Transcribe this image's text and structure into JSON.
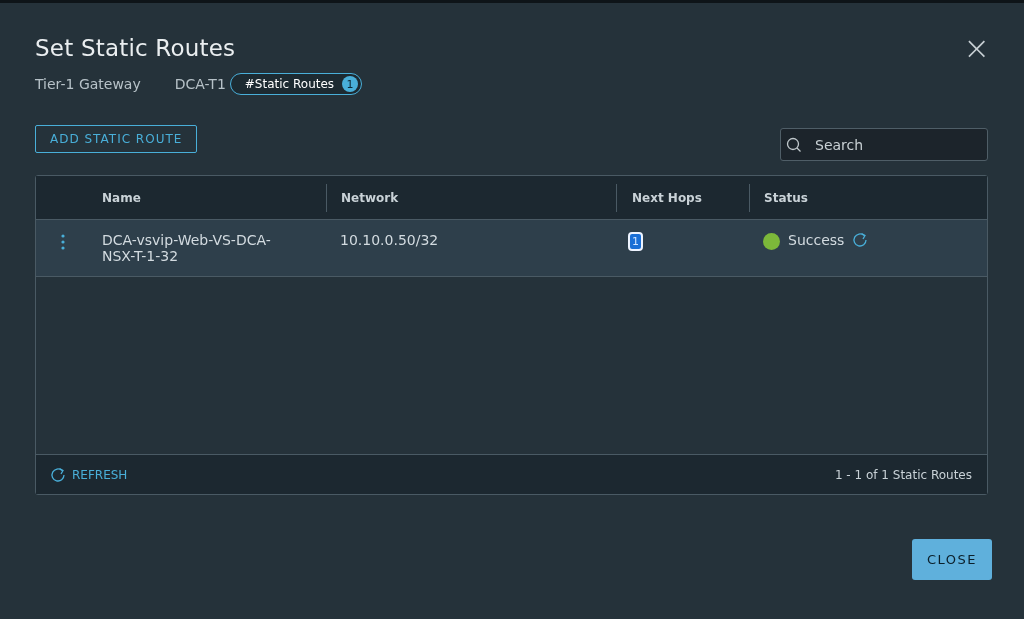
{
  "dialog": {
    "title": "Set Static Routes",
    "close_icon": "×"
  },
  "info": {
    "gateway_label": "Tier-1 Gateway",
    "gateway_name": "DCA-T1",
    "badge_label": "#Static Routes",
    "badge_count": "1"
  },
  "add_button": "ADD STATIC ROUTE",
  "search": {
    "placeholder": "Search"
  },
  "table": {
    "columns": [
      "Name",
      "Network",
      "Next Hops",
      "Status"
    ],
    "rows": [
      {
        "selected": true,
        "name": "DCA-vsvip-Web-VS-DCA-NSX-T-1-32",
        "network": "10.10.0.50/32",
        "next_hops": "1",
        "status": "Success",
        "color": "#7cb83a"
      }
    ],
    "refresh": "REFRESH",
    "count": "1 - 1 of 1 Static Routes"
  },
  "buttons": [
    "CLOSE"
  ]
}
